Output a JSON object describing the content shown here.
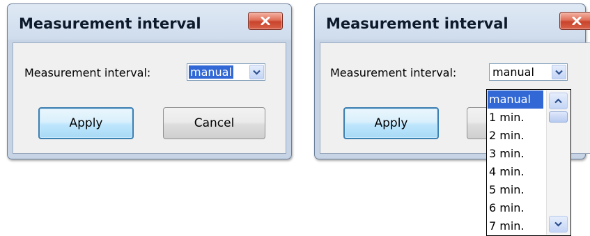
{
  "colors": {
    "selection": "#3168d5",
    "close_button": "#c9432b",
    "title_bar": "#cfdcec",
    "client_bg": "#f0f0f0"
  },
  "dialog1": {
    "title": "Measurement interval",
    "label": "Measurement interval:",
    "combo_value": "manual",
    "apply_label": "Apply",
    "cancel_label": "Cancel"
  },
  "dialog2": {
    "title": "Measurement interval",
    "label": "Measurement interval:",
    "combo_value": "manual",
    "apply_label": "Apply",
    "options": [
      "manual",
      "1 min.",
      "2 min.",
      "3 min.",
      "4 min.",
      "5 min.",
      "6 min.",
      "7 min."
    ],
    "selected_index": 0
  },
  "icons": {
    "close": "close-icon",
    "dropdown_arrow": "chevron-down-icon",
    "scroll_up": "chevron-up-icon",
    "scroll_down": "chevron-down-icon"
  }
}
